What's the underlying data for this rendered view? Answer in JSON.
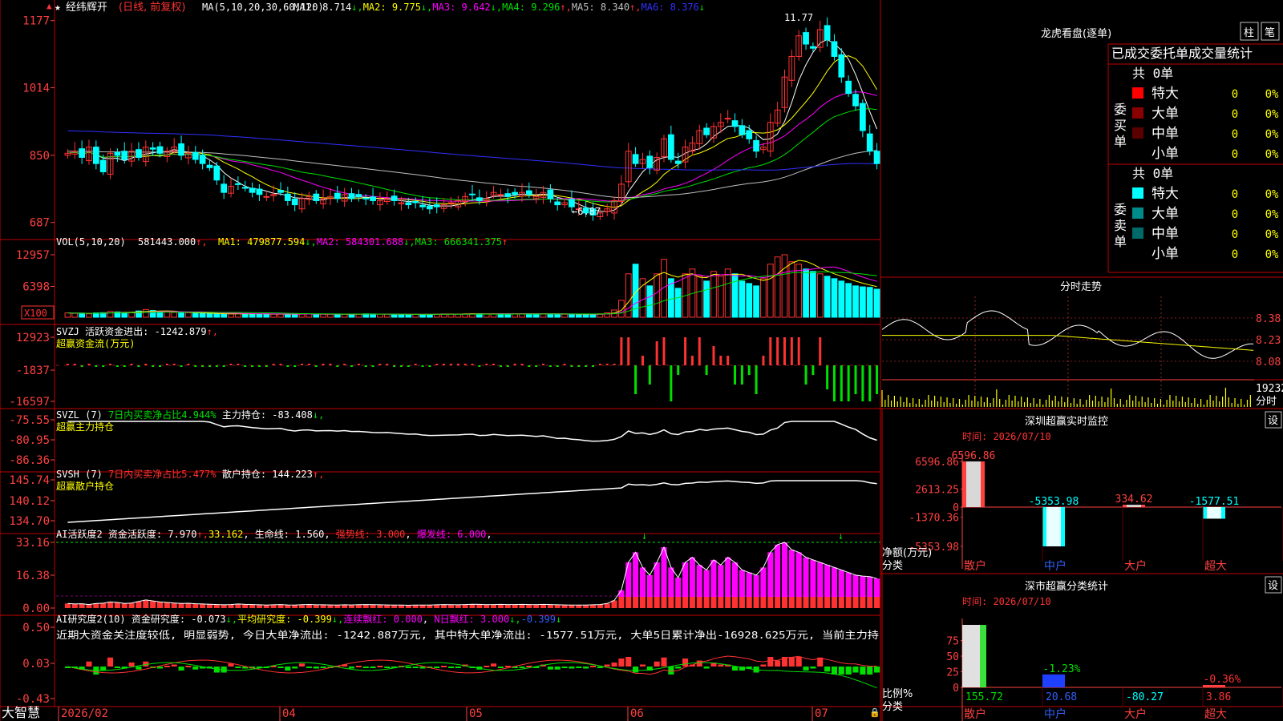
{
  "colors": {
    "bg": "#000000",
    "frame": "#c00000",
    "up": "#ff3232",
    "down": "#00ffff",
    "white": "#ffffff",
    "yellow": "#ffff00",
    "magenta": "#ff00ff",
    "green": "#00e000",
    "blue": "#3030ff",
    "grey": "#c0c0c0",
    "label": "#ff4040"
  },
  "price_panel": {
    "star": "★",
    "name": "经纬辉开",
    "period": "(日线, 前复权)",
    "ma_title": "MA(5,10,20,30,60,120)",
    "ma_values": [
      {
        "label": "MA1: 8.714",
        "arrow": "↓",
        "color": "#ffffff"
      },
      {
        "label": "MA2: 9.775",
        "arrow": "↓",
        "color": "#ffff00"
      },
      {
        "label": "MA3: 9.642",
        "arrow": "↓",
        "color": "#ff00ff"
      },
      {
        "label": "MA4: 9.296",
        "arrow": "↑",
        "color": "#00e000"
      },
      {
        "label": "MA5: 8.340",
        "arrow": "↑",
        "color": "#c0c0c0"
      },
      {
        "label": "MA6: 8.376",
        "arrow": "↓",
        "color": "#3030ff"
      }
    ],
    "y_ticks": [
      "1177",
      "1014",
      "850",
      "687"
    ],
    "high_note": "11.77",
    "low_note": "6.87"
  },
  "vol_panel": {
    "title": "VOL(5,10,20)",
    "value": "581443.000",
    "ma_values": [
      {
        "label": "MA1: 479877.594",
        "arrow": "↓",
        "color": "#ffff00"
      },
      {
        "label": "MA2: 584301.688",
        "arrow": "↓",
        "color": "#ff00ff"
      },
      {
        "label": "MA3: 666341.375",
        "arrow": "↑",
        "color": "#00e000"
      }
    ],
    "y_ticks": [
      "12957",
      "6398"
    ],
    "unit": "X100"
  },
  "svzj_panel": {
    "title": "SVZJ  活跃资金进出: -1242.879",
    "arrow": "↑,",
    "subtitle": "超赢资金流(万元)",
    "y_ticks": [
      "12923",
      "-1837",
      "-16597"
    ]
  },
  "svzl_panel": {
    "title": "SVZL (7)",
    "ratio": "7日内买卖净占比4.944%",
    "holding": "主力持仓: -83.408",
    "arrow": "↓,",
    "subtitle": "超赢主力持仓",
    "y_ticks": [
      "-75.55",
      "-80.95",
      "-86.36"
    ]
  },
  "svsh_panel": {
    "title": "SVSH (7)",
    "ratio": "7日内买卖净占比5.477%",
    "holding": "散户持仓: 144.223",
    "arrow": "↑,",
    "subtitle": "超赢散户持仓",
    "y_ticks": [
      "145.74",
      "140.12",
      "134.70"
    ]
  },
  "ai1_panel": {
    "title": "AI活跃度2",
    "v1": "资金活跃度: 7.970",
    "a1": "↑,",
    "v2": "33.162",
    "v3": "生命线: 1.560",
    "v4": "强势线: 3.000",
    "v5": "爆发线: 6.000",
    "y_ticks": [
      "33.16",
      "16.38",
      "0.00"
    ]
  },
  "ai2_panel": {
    "title": "AI研究度2(10)",
    "v1": "资金研究度: -0.073",
    "a1": "↓,",
    "v2": "平均研究度: -0.399",
    "a2": "↓,",
    "v3": "连续飘红: 0.000",
    "v4": "N日飘红: 3.000",
    "a4": "↓,",
    "v5": "-0.399",
    "a5": "↓",
    "note": "近期大资金关注度较低, 明显弱势, 今日大单净流出: -1242.887万元, 其中特大单净流出: -1577.51万元, 大单5日累计净出-16928.625万元, 当前主力持",
    "y_ticks": [
      "0.50",
      "0.03",
      "-0.43"
    ]
  },
  "x_axis": {
    "brand": "大智慧",
    "labels": [
      "2026/02",
      "04",
      "05",
      "06",
      "07"
    ]
  },
  "right_panel": {
    "longhu_title": "龙虎看盘(逐单)",
    "btn_zhu": "柱",
    "btn_bi": "笔",
    "stats_title": "已成交委托单成交量统计",
    "buy_side": "委买单",
    "sell_side": "委卖单",
    "buy_total": "共 0单",
    "sell_total": "共 0单",
    "buy_rows": [
      {
        "name": "特大",
        "count": "0",
        "pct": "0%",
        "color": "#ff0000"
      },
      {
        "name": "大单",
        "count": "0",
        "pct": "0%",
        "color": "#8b0000"
      },
      {
        "name": "中单",
        "count": "0",
        "pct": "0%",
        "color": "#5a0000"
      },
      {
        "name": "小单",
        "count": "0",
        "pct": "0%",
        "color": ""
      }
    ],
    "sell_rows": [
      {
        "name": "特大",
        "count": "0",
        "pct": "0%",
        "color": "#00ffff"
      },
      {
        "name": "大单",
        "count": "0",
        "pct": "0%",
        "color": "#008b8b"
      },
      {
        "name": "中单",
        "count": "0",
        "pct": "0%",
        "color": "#006a6a"
      },
      {
        "name": "小单",
        "count": "0",
        "pct": "0%",
        "color": ""
      }
    ],
    "intraday_title": "分时走势",
    "intraday_ticks": [
      "8.38",
      "8.23",
      "8.08"
    ],
    "intraday_vol": "19232",
    "intraday_vol_unit": "分时",
    "monitor_title": "深圳超赢实时监控",
    "monitor_time": "时间: 2026/07/10",
    "monitor_btn": "设",
    "monitor_ticks": [
      "6596.86",
      "2613.25",
      "0",
      "-1370.36",
      "-5353.98"
    ],
    "monitor_values": [
      {
        "label": "6596.86",
        "value": 6596.86,
        "color": "#ff4040"
      },
      {
        "label": "-5353.98",
        "value": -5353.98,
        "color": "#00ffff"
      },
      {
        "label": "334.62",
        "value": 334.62,
        "color": "#ff4040"
      },
      {
        "label": "-1577.51",
        "value": -1577.51,
        "color": "#00ffff"
      }
    ],
    "monitor_unit": "净额(万元)",
    "monitor_cat_label": "分类",
    "categories": [
      "散户",
      "中户",
      "大户",
      "超大"
    ],
    "class_title": "深市超赢分类统计",
    "class_time": "时间: 2026/07/10",
    "class_btn": "设",
    "class_ticks": [
      "75",
      "50",
      "25",
      "0"
    ],
    "class_values": [
      {
        "top": "",
        "bottom": "155.72",
        "value": 100,
        "color": "#e0e0e0"
      },
      {
        "top": "-1.23%",
        "bottom": "20.68",
        "value": 20.68,
        "color": "#2040ff"
      },
      {
        "top": "",
        "bottom": "-80.27",
        "value": 0,
        "color": "#00ffff"
      },
      {
        "top": "-0.36%",
        "bottom": "3.86",
        "value": 3.86,
        "color": "#ff4040"
      }
    ],
    "class_unit": "比例%",
    "class_cat_label": "分类"
  },
  "chart_data": {
    "type": "candlestick",
    "title": "经纬辉开 (日线, 前复权)",
    "price_range": [
      6.87,
      11.77
    ],
    "closes": [
      8.55,
      8.6,
      8.45,
      8.7,
      8.3,
      8.1,
      8.55,
      8.5,
      8.4,
      8.6,
      8.45,
      8.7,
      8.65,
      8.55,
      8.6,
      8.7,
      8.5,
      8.55,
      8.4,
      8.3,
      8.2,
      7.9,
      7.6,
      7.75,
      7.8,
      7.7,
      7.6,
      7.55,
      7.5,
      7.55,
      7.6,
      7.4,
      7.3,
      7.45,
      7.5,
      7.4,
      7.45,
      7.5,
      7.45,
      7.55,
      7.45,
      7.5,
      7.45,
      7.4,
      7.4,
      7.45,
      7.4,
      7.35,
      7.3,
      7.35,
      7.25,
      7.2,
      7.25,
      7.3,
      7.35,
      7.4,
      7.5,
      7.55,
      7.4,
      7.45,
      7.6,
      7.55,
      7.5,
      7.55,
      7.6,
      7.55,
      7.5,
      7.6,
      7.45,
      7.3,
      7.35,
      7.25,
      7.2,
      7.1,
      7.05,
      7.1,
      7.2,
      7.4,
      7.8,
      8.6,
      8.3,
      8.4,
      8.2,
      8.45,
      8.9,
      8.4,
      8.3,
      8.7,
      8.8,
      9.1,
      9.0,
      9.2,
      9.3,
      9.4,
      9.2,
      9.0,
      8.9,
      8.6,
      8.7,
      9.3,
      9.6,
      10.4,
      10.9,
      11.4,
      11.2,
      11.1,
      11.55,
      11.3,
      10.9,
      10.4,
      10.0,
      9.7,
      9.1,
      8.6,
      8.3
    ],
    "volume_x100": [
      900,
      800,
      850,
      700,
      900,
      950,
      1200,
      1100,
      900,
      1000,
      1300,
      1600,
      1400,
      1200,
      1100,
      1000,
      900,
      950,
      850,
      800,
      750,
      700,
      650,
      700,
      800,
      720,
      690,
      650,
      600,
      640,
      700,
      620,
      600,
      680,
      710,
      650,
      640,
      620,
      600,
      640,
      620,
      660,
      700,
      680,
      650,
      620,
      600,
      580,
      560,
      600,
      580,
      600,
      640,
      700,
      680,
      650,
      700,
      760,
      720,
      680,
      700,
      720,
      700,
      690,
      720,
      700,
      680,
      720,
      700,
      650,
      620,
      600,
      580,
      600,
      650,
      700,
      900,
      1500,
      3500,
      9000,
      11000,
      8000,
      6500,
      9000,
      12000,
      8000,
      6000,
      9000,
      10000,
      8500,
      7500,
      9500,
      8500,
      10000,
      9000,
      7500,
      7000,
      6500,
      8000,
      11000,
      12500,
      12957,
      11500,
      11000,
      10000,
      9500,
      9000,
      8500,
      8000,
      7500,
      7000,
      6500,
      6300,
      6200,
      5814
    ],
    "vol_range": [
      0,
      12957
    ]
  }
}
